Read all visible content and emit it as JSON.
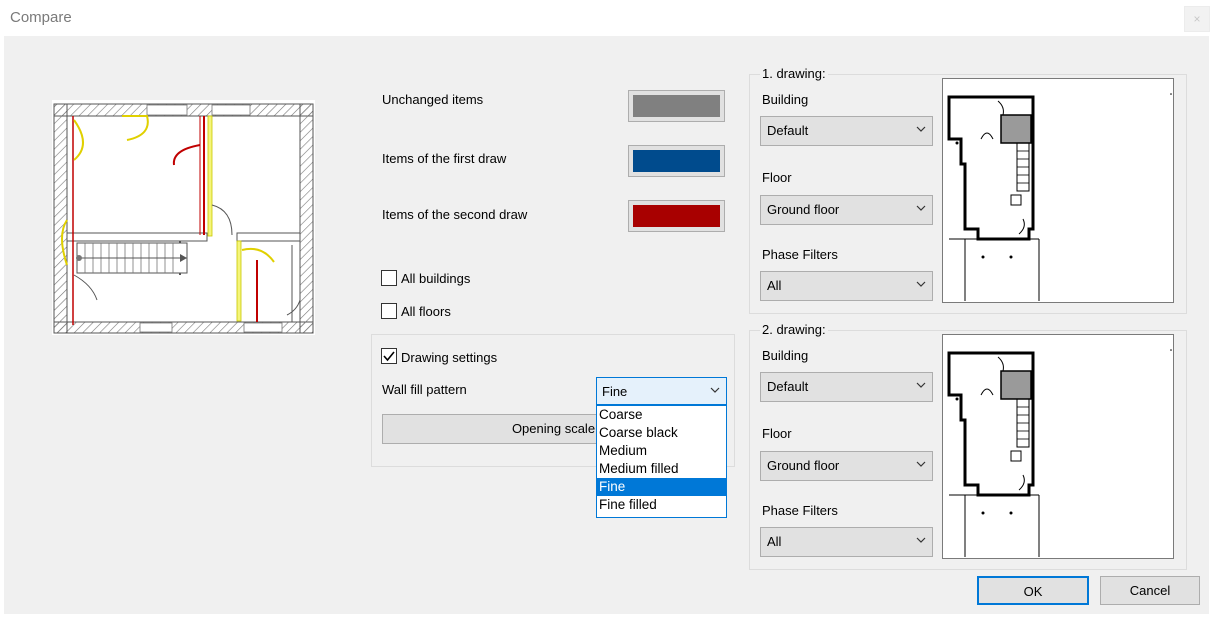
{
  "window": {
    "title": "Compare",
    "close_label": "×"
  },
  "legend_colors": {
    "unchanged_label": "Unchanged items",
    "unchanged_color": "#808080",
    "first_label": "Items of the first draw",
    "first_color": "#004b8d",
    "second_label": "Items of the second draw",
    "second_color": "#a80000"
  },
  "options": {
    "all_buildings": "All buildings",
    "all_buildings_checked": false,
    "all_floors": "All floors",
    "all_floors_checked": false
  },
  "drawing_settings": {
    "label": "Drawing settings",
    "checked": true,
    "wall_fill_label": "Wall fill pattern",
    "wall_fill_value": "Fine",
    "wall_fill_options": [
      "Coarse",
      "Coarse black",
      "Medium",
      "Medium filled",
      "Fine",
      "Fine filled"
    ],
    "wall_fill_selected_index": 4,
    "opening_scale_label": "Opening scale"
  },
  "drawing1": {
    "legend": "1. drawing:",
    "building_label": "Building",
    "building_value": "Default",
    "floor_label": "Floor",
    "floor_value": "Ground floor",
    "phase_label": "Phase Filters",
    "phase_value": "All"
  },
  "drawing2": {
    "legend": "2. drawing:",
    "building_label": "Building",
    "building_value": "Default",
    "floor_label": "Floor",
    "floor_value": "Ground floor",
    "phase_label": "Phase Filters",
    "phase_value": "All"
  },
  "buttons": {
    "ok": "OK",
    "cancel": "Cancel"
  }
}
